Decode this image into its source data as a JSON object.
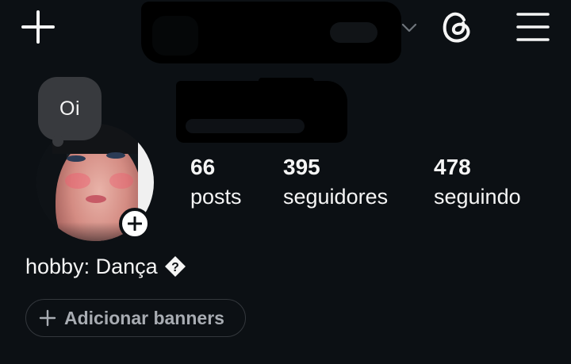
{
  "header": {
    "create_icon": "plus-icon",
    "account_switch_icon": "chevron-down-icon",
    "threads_icon": "threads-icon",
    "menu_icon": "hamburger-menu-icon"
  },
  "note": {
    "text": "Oi"
  },
  "avatar": {
    "add_icon": "plus-icon"
  },
  "stats": {
    "posts": {
      "value": "66",
      "label": "posts"
    },
    "followers": {
      "value": "395",
      "label": "seguidores"
    },
    "following": {
      "value": "478",
      "label": "seguindo"
    }
  },
  "bio": {
    "text": "hobby: Dança",
    "glyph_icon": "unknown-character-icon"
  },
  "banner_button": {
    "label": "Adicionar banners",
    "icon": "plus-icon"
  },
  "colors": {
    "background": "#0c1014",
    "text": "#f5f5f5",
    "note_bubble": "#383a3e",
    "button_border": "#34383d",
    "button_text": "#a8acb2"
  }
}
